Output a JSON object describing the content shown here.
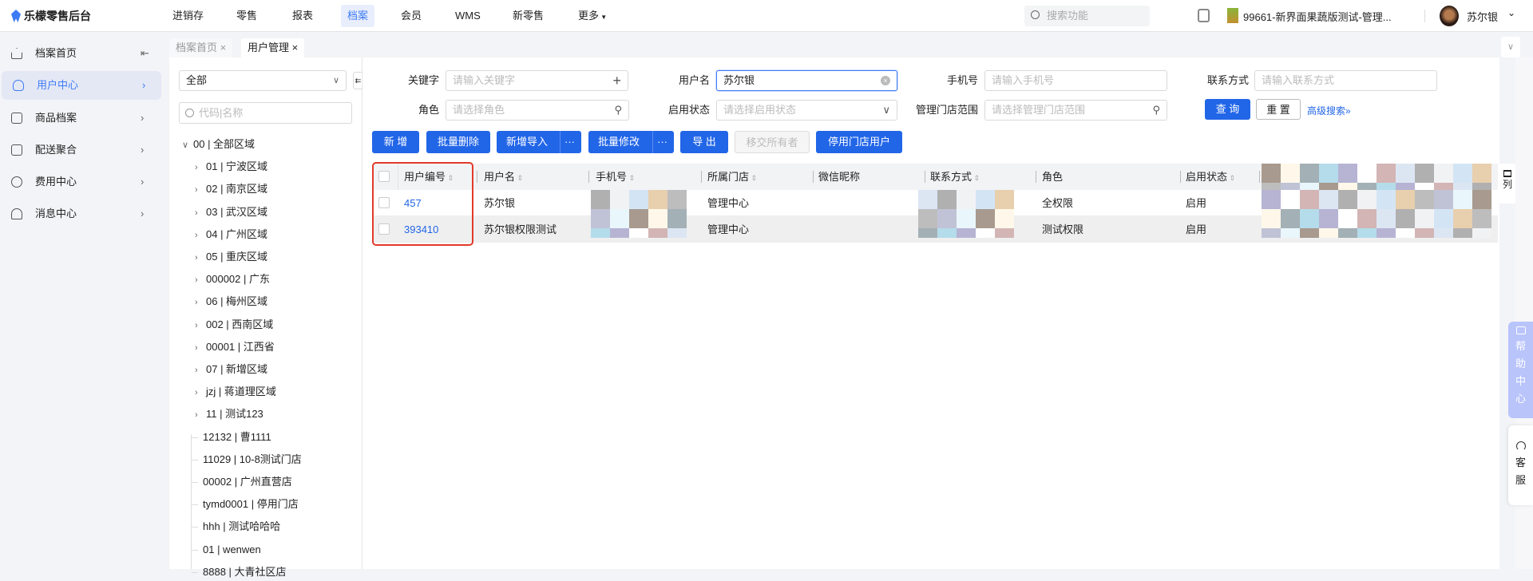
{
  "header": {
    "app_title": "乐檬零售后台",
    "nav": [
      "进销存",
      "零售",
      "报表",
      "档案",
      "会员",
      "WMS",
      "新零售",
      "更多"
    ],
    "active_nav": "档案",
    "search_placeholder": "搜索功能",
    "store": "99661-新界面果蔬版测试-管理...",
    "user": "苏尔银"
  },
  "tabs": [
    {
      "label": "档案首页",
      "close": "×"
    },
    {
      "label": "用户管理",
      "close": "×"
    }
  ],
  "sidebar": {
    "items": [
      {
        "label": "档案首页",
        "icon": "home-icon"
      },
      {
        "label": "用户中心",
        "icon": "user-icon"
      },
      {
        "label": "商品档案",
        "icon": "product-icon"
      },
      {
        "label": "配送聚合",
        "icon": "map-icon"
      },
      {
        "label": "费用中心",
        "icon": "yen-icon"
      },
      {
        "label": "消息中心",
        "icon": "bell-icon"
      }
    ],
    "collapse_glyph": "⇤"
  },
  "tree": {
    "select_value": "全部",
    "search_placeholder": "代码|名称",
    "nodes": [
      "00 | 全部区域",
      "01 | 宁波区域",
      "02 | 南京区域",
      "03 | 武汉区域",
      "04 | 广州区域",
      "05 | 重庆区域",
      "000002 | 广东",
      "06 | 梅州区域",
      "002 | 西南区域",
      "00001 | 江西省",
      "07 | 新增区域",
      "jzj | 蒋道理区域",
      "11 | 测试123",
      "12132 | 曹1111",
      "11029 | 10-8测试门店",
      "00002 | 广州直营店",
      "tymd0001 | 停用门店",
      "hhh | 测试哈哈哈",
      "01 | wenwen",
      "8888 | 大青社区店"
    ]
  },
  "filters": {
    "keyword": {
      "label": "关键字",
      "placeholder": "请输入关键字"
    },
    "username": {
      "label": "用户名",
      "value": "苏尔银"
    },
    "phone": {
      "label": "手机号",
      "placeholder": "请输入手机号"
    },
    "contact": {
      "label": "联系方式",
      "placeholder": "请输入联系方式"
    },
    "role": {
      "label": "角色",
      "placeholder": "请选择角色"
    },
    "status": {
      "label": "启用状态",
      "placeholder": "请选择启用状态"
    },
    "stores": {
      "label": "管理门店范围",
      "placeholder": "请选择管理门店范围"
    },
    "query": "查 询",
    "reset": "重 置",
    "advanced": "高级搜索"
  },
  "actions": [
    "新 增",
    "批量删除",
    "新增导入",
    "批量修改",
    "导 出",
    "移交所有者",
    "停用门店用户"
  ],
  "more_glyph": "···",
  "table": {
    "columns": [
      "用户编号",
      "用户名",
      "手机号",
      "所属门店",
      "微信昵称",
      "联系方式",
      "角色",
      "启用状态"
    ],
    "rows": [
      {
        "id": "457",
        "name": "苏尔银",
        "store": "管理中心",
        "role": "全权限",
        "status": "启用"
      },
      {
        "id": "393410",
        "name": "苏尔银权限测试",
        "store": "管理中心",
        "role": "测试权限",
        "status": "启用"
      }
    ],
    "column_settings": "列"
  },
  "float": {
    "help": [
      "帮",
      "助",
      "中",
      "心"
    ],
    "service": [
      "客",
      "服"
    ]
  }
}
